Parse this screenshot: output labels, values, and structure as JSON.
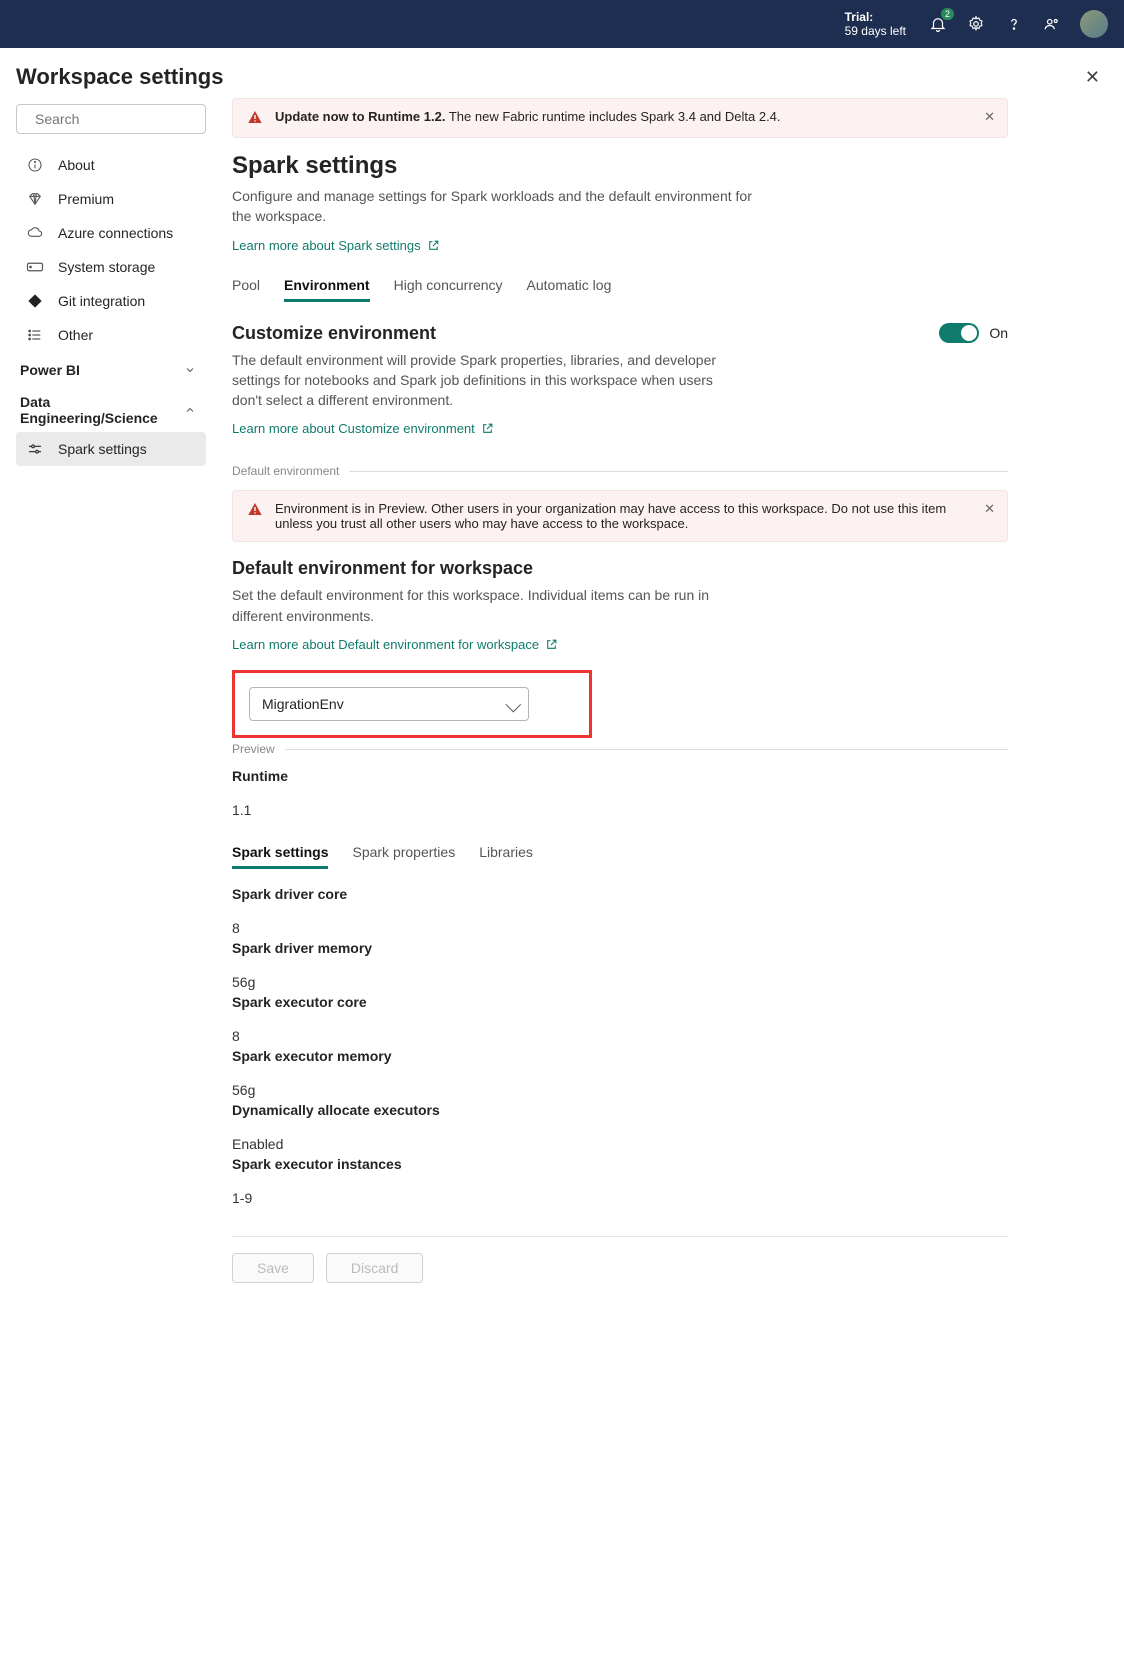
{
  "topbar": {
    "trial_label": "Trial:",
    "trial_days": "59 days left",
    "notif_count": "2"
  },
  "page_title": "Workspace settings",
  "search": {
    "placeholder": "Search"
  },
  "sidebar": {
    "items": [
      {
        "label": "About"
      },
      {
        "label": "Premium"
      },
      {
        "label": "Azure connections"
      },
      {
        "label": "System storage"
      },
      {
        "label": "Git integration"
      },
      {
        "label": "Other"
      }
    ],
    "group_powerbi": "Power BI",
    "group_data": "Data Engineering/Science",
    "sub_spark": "Spark settings"
  },
  "banner_update": {
    "bold": "Update now to Runtime 1.2.",
    "rest": " The new Fabric runtime includes Spark 3.4 and Delta 2.4."
  },
  "spark": {
    "title": "Spark settings",
    "desc": "Configure and manage settings for Spark workloads and the default environment for the workspace.",
    "learn": "Learn more about Spark settings"
  },
  "tabs_main": [
    "Pool",
    "Environment",
    "High concurrency",
    "Automatic log"
  ],
  "customize": {
    "title": "Customize environment",
    "desc": "The default environment will provide Spark properties, libraries, and developer settings for notebooks and Spark job definitions in this workspace when users don't select a different environment.",
    "learn": "Learn more about Customize environment",
    "toggle_label": "On"
  },
  "legend_default_env": "Default environment",
  "banner_preview": "Environment is in Preview. Other users in your organization may have access to this workspace. Do not use this item unless you trust all other users who may have access to the workspace.",
  "default_env": {
    "title": "Default environment for workspace",
    "desc": "Set the default environment for this workspace. Individual items can be run in different environments.",
    "learn": "Learn more about Default environment for workspace",
    "selected": "MigrationEnv"
  },
  "legend_preview": "Preview",
  "runtime": {
    "label": "Runtime",
    "value": "1.1"
  },
  "tabs_preview": [
    "Spark settings",
    "Spark properties",
    "Libraries"
  ],
  "spark_values": {
    "driver_core_label": "Spark driver core",
    "driver_core": "8",
    "driver_mem_label": "Spark driver memory",
    "driver_mem": "56g",
    "exec_core_label": "Spark executor core",
    "exec_core": "8",
    "exec_mem_label": "Spark executor memory",
    "exec_mem": "56g",
    "dyn_label": "Dynamically allocate executors",
    "dyn": "Enabled",
    "inst_label": "Spark executor instances",
    "inst": "1-9"
  },
  "buttons": {
    "save": "Save",
    "discard": "Discard"
  }
}
